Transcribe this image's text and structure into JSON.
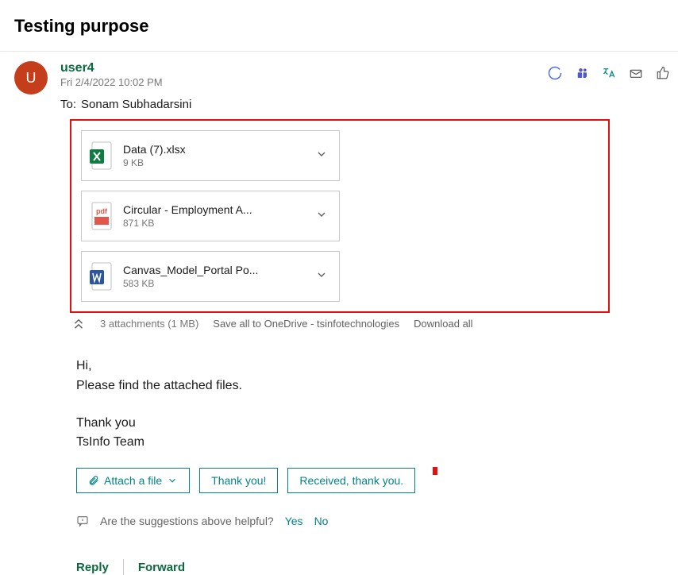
{
  "subject": "Testing purpose",
  "sender": {
    "initial": "U",
    "name": "user4",
    "date": "Fri 2/4/2022 10:02 PM"
  },
  "to": {
    "label": "To:",
    "value": "Sonam Subhadarsini"
  },
  "attachments": [
    {
      "name": "Data (7).xlsx",
      "size": "9 KB",
      "type": "excel"
    },
    {
      "name": "Circular - Employment A...",
      "size": "871 KB",
      "type": "pdf"
    },
    {
      "name": "Canvas_Model_Portal Po...",
      "size": "583 KB",
      "type": "word"
    }
  ],
  "attach_meta": {
    "count": "3 attachments (1 MB)",
    "save_all": "Save all to OneDrive - tsinfotechnologies",
    "download_all": "Download all"
  },
  "body": {
    "line1": "Hi,",
    "line2": "Please find the attached files.",
    "line3": "Thank you",
    "line4": "TsInfo Team"
  },
  "actions": {
    "attach": "Attach a file",
    "reply1": "Thank you!",
    "reply2": "Received, thank you."
  },
  "feedback": {
    "question": "Are the suggestions above helpful?",
    "yes": "Yes",
    "no": "No"
  },
  "reply_actions": {
    "reply": "Reply",
    "forward": "Forward"
  }
}
